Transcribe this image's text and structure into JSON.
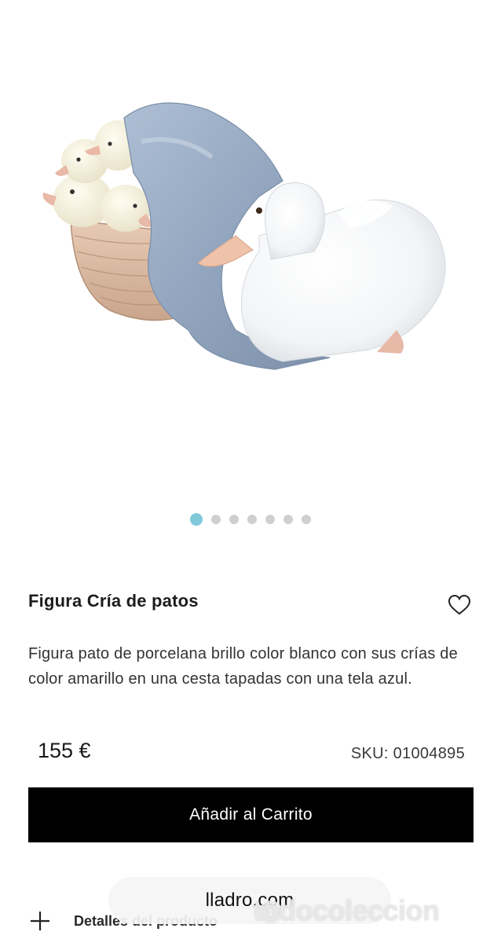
{
  "product": {
    "title": "Figura Cría de patos",
    "description": "Figura pato de porcelana brillo color blanco con sus crías de color amarillo en una cesta tapadas con una tela azul.",
    "price": "155 €",
    "sku": "SKU: 01004895"
  },
  "gallery": {
    "image_count": 7,
    "active_index": 0
  },
  "actions": {
    "add_to_cart_label": "Añadir al Carrito"
  },
  "details": {
    "label": "Detalles del producto"
  },
  "browser": {
    "url": "lladro.com"
  },
  "watermark": {
    "text": "todocoleccion"
  },
  "icons": {
    "favorite": "heart-outline-icon",
    "expand": "plus-icon"
  },
  "colors": {
    "accent_dot": "#7fc9da",
    "inactive_dot": "#cfcfcf",
    "button_bg": "#000000",
    "button_text": "#ffffff"
  }
}
